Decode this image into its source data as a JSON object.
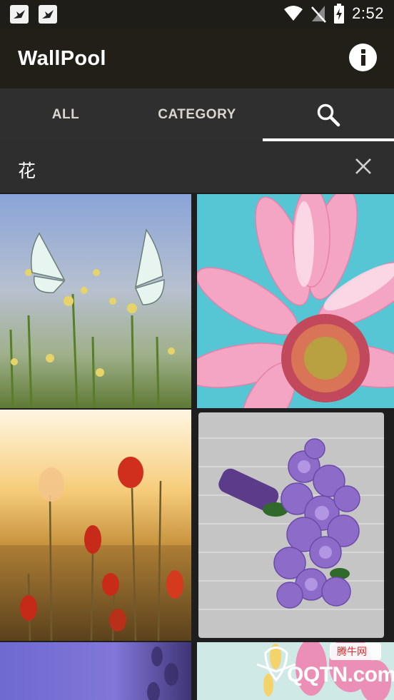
{
  "status_bar": {
    "time": "2:52",
    "notification_icons": [
      "bird-notification-icon",
      "bird-notification-icon"
    ],
    "status_icons": [
      "wifi-icon",
      "no-signal-icon",
      "battery-charging-icon"
    ]
  },
  "app_bar": {
    "title": "WallPool",
    "info_icon": "info-icon"
  },
  "tabs": [
    {
      "label": "ALL",
      "selected": false
    },
    {
      "label": "CATEGORY",
      "selected": false
    },
    {
      "label": "",
      "icon": "search-icon",
      "selected": true
    }
  ],
  "search": {
    "query": "花",
    "clear_icon": "close-icon"
  },
  "results": [
    {
      "subject": "butterflies-on-flowers"
    },
    {
      "subject": "pink-daisy"
    },
    {
      "subject": "poppies-at-sunset"
    },
    {
      "subject": "purple-bouquet"
    },
    {
      "subject": "purple-flowers"
    },
    {
      "subject": "pink-flowers"
    }
  ],
  "watermark": {
    "brand": "QQTN.com",
    "tag": "腾牛网"
  },
  "colors": {
    "app_bar": "#211f18",
    "tabs_bg": "#2f2f2f",
    "indicator": "#ffffff"
  }
}
